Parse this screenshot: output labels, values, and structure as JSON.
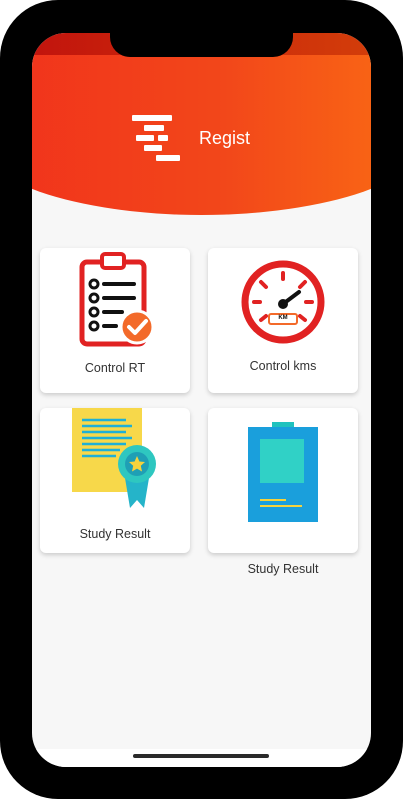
{
  "app": {
    "name": "Regist"
  },
  "menu": {
    "items": [
      {
        "label": "Control RT"
      },
      {
        "label": "Control kms",
        "gauge_unit": "KM"
      },
      {
        "label": "Study Result"
      },
      {
        "label": "Study Result"
      }
    ]
  },
  "colors": {
    "header_start": "#f1301c",
    "header_end": "#fb6e13",
    "accent_red": "#e12222",
    "check_orange": "#f36a2a"
  }
}
